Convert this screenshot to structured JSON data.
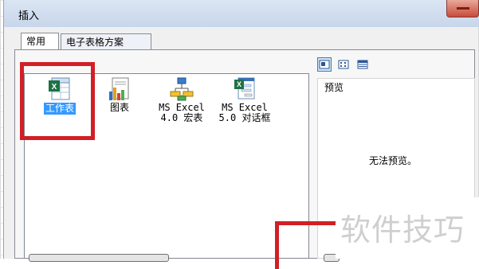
{
  "dialog": {
    "title": "插入",
    "close_label": ""
  },
  "tabs": [
    {
      "label": "常用",
      "active": true
    },
    {
      "label": "电子表格方案",
      "active": false
    }
  ],
  "items": [
    {
      "label": "工作表",
      "icon": "worksheet-icon",
      "selected": true
    },
    {
      "label": "图表",
      "icon": "chart-icon",
      "selected": false
    },
    {
      "label": "MS Excel\n4.0 宏表",
      "icon": "macro-sheet-icon",
      "selected": false
    },
    {
      "label": "MS Excel\n5.0 对话框",
      "icon": "dialog-sheet-icon",
      "selected": false
    }
  ],
  "view_modes": [
    "large-icons",
    "list",
    "details"
  ],
  "preview": {
    "label": "预览",
    "empty_text": "无法预览。"
  },
  "watermark": "软件技巧",
  "colors": {
    "highlight": "#d21f26",
    "selection": "#3399ff",
    "titlebar": "#c7d6ea"
  }
}
